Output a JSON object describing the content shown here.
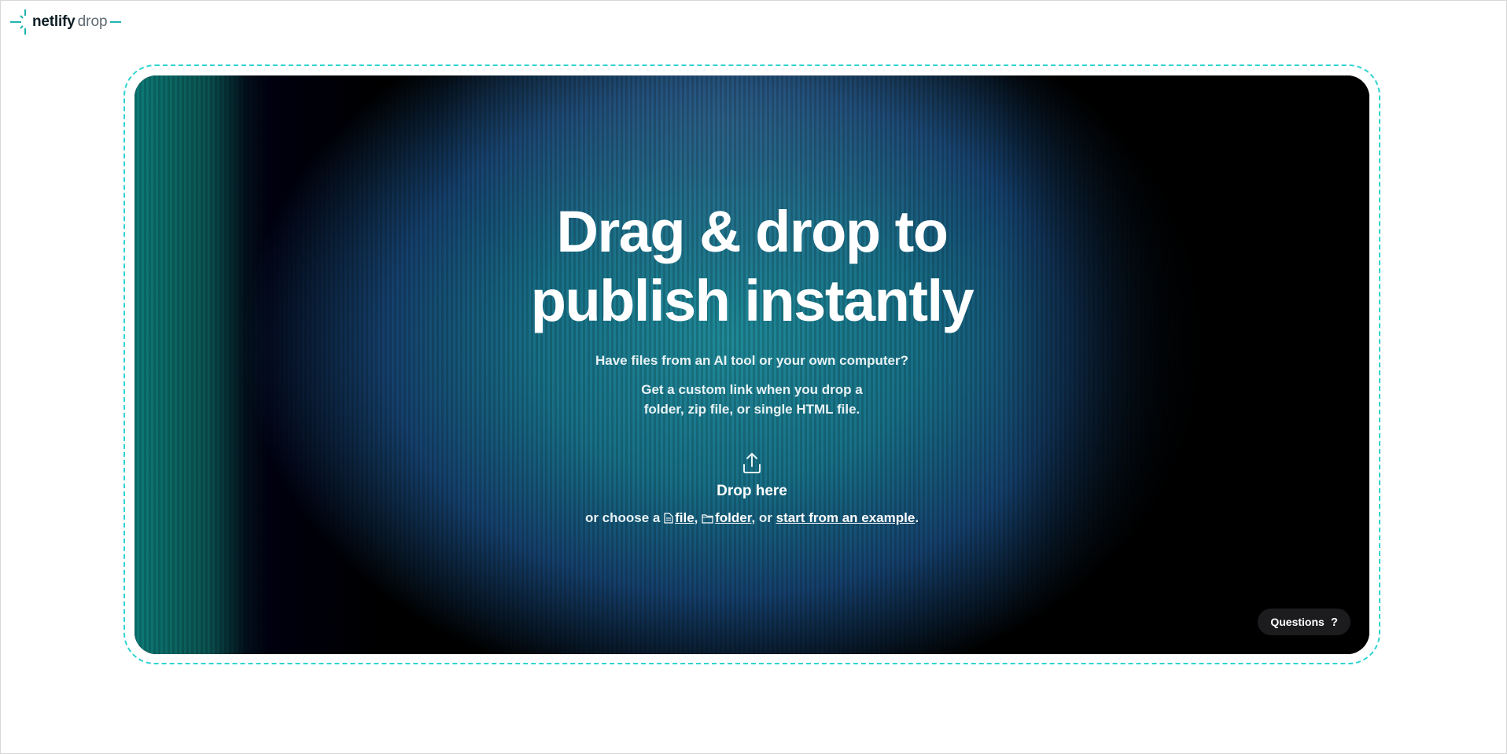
{
  "logo": {
    "brand": "netlify",
    "product": "drop"
  },
  "hero": {
    "title": "Drag & drop to publish instantly",
    "subtitle": "Have files from an AI tool or your own computer?",
    "description": "Get a custom link when you drop a folder, zip file, or single HTML file."
  },
  "dropzone": {
    "label": "Drop here",
    "choose_prefix": "or choose a",
    "file_link": "file",
    "separator1": ",",
    "folder_link": "folder",
    "separator2": ", or",
    "example_link": "start from an example",
    "suffix": "."
  },
  "questions": {
    "label": "Questions",
    "icon": "?"
  },
  "colors": {
    "accent": "#2fd3d0",
    "brand_text": "#0e1e25"
  }
}
